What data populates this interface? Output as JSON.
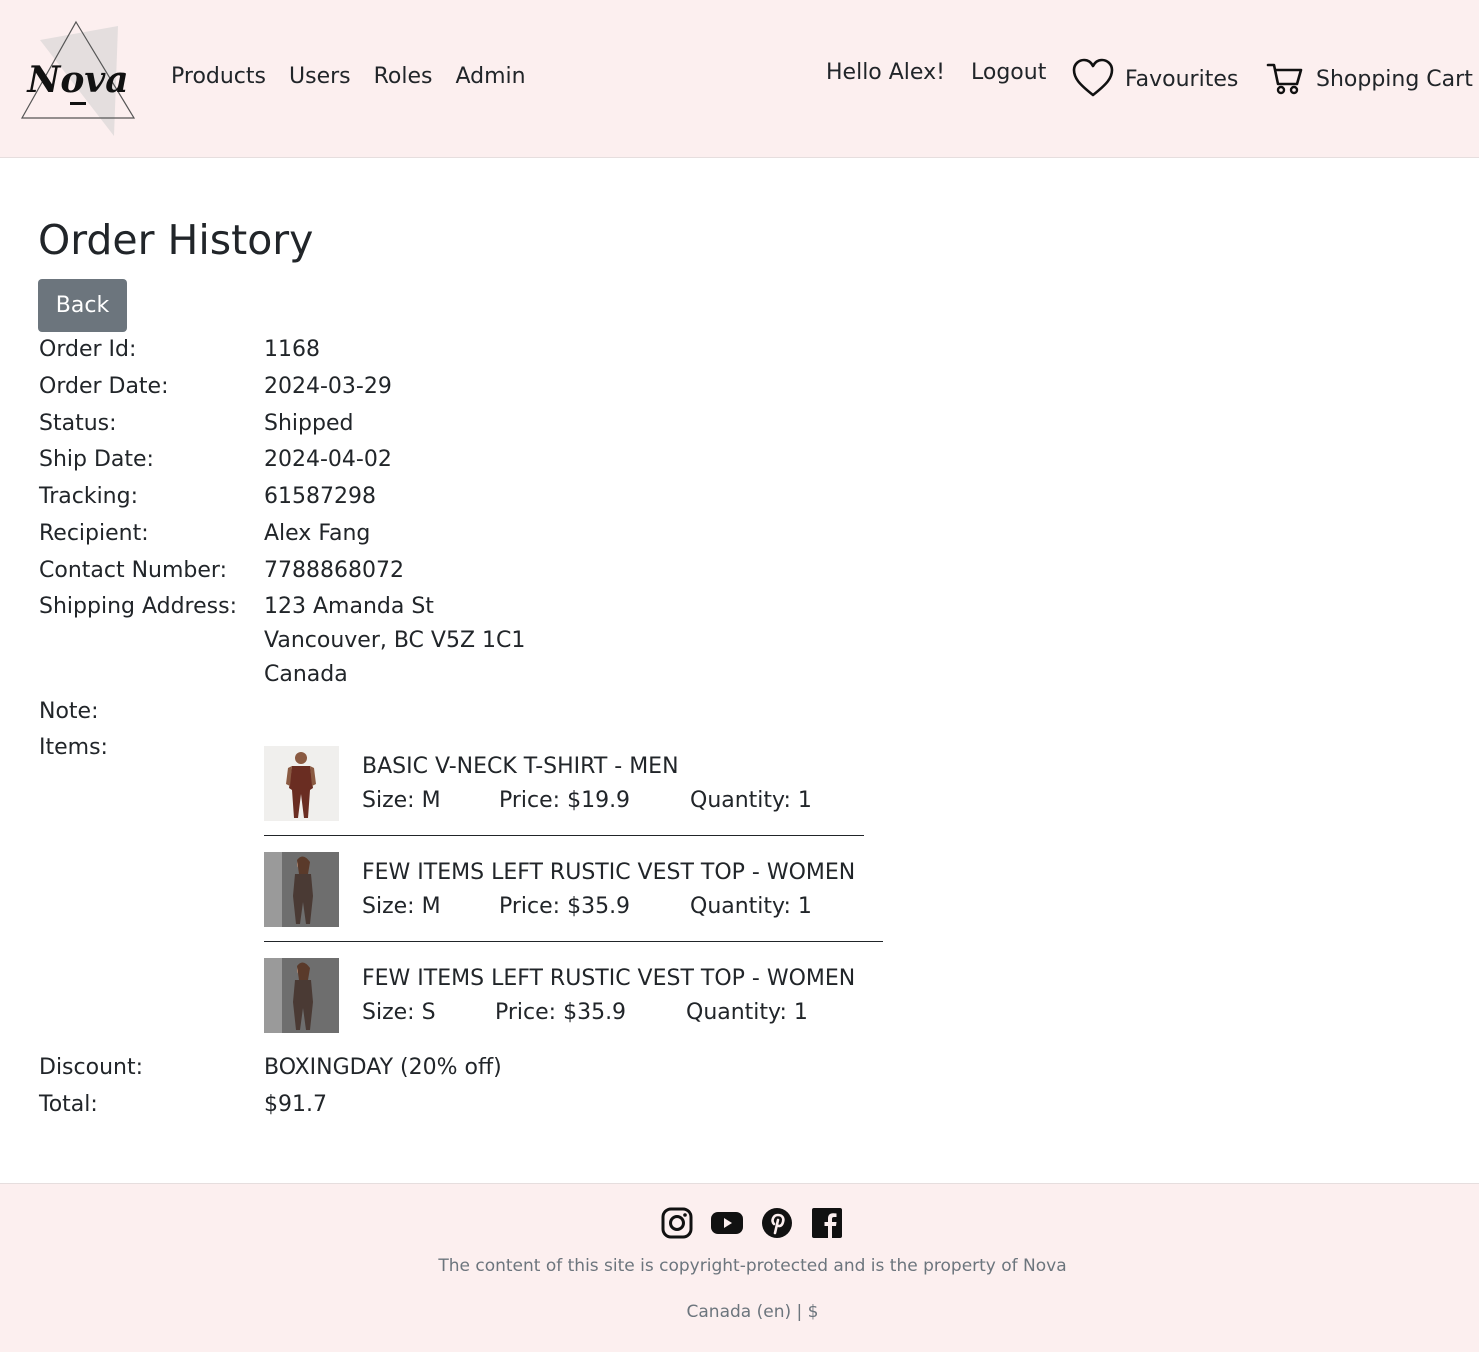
{
  "brand": {
    "logo_text": "Nova"
  },
  "nav": {
    "products": "Products",
    "users": "Users",
    "roles": "Roles",
    "admin": "Admin",
    "greeting": "Hello Alex!",
    "logout": "Logout",
    "favourites": "Favourites",
    "cart": "Shopping Cart"
  },
  "page": {
    "title": "Order History",
    "back_label": "Back"
  },
  "order": {
    "labels": {
      "id": "Order Id:",
      "date": "Order Date:",
      "status": "Status:",
      "ship_date": "Ship Date:",
      "tracking": "Tracking:",
      "recipient": "Recipient:",
      "contact": "Contact Number:",
      "address": "Shipping Address:",
      "note": "Note:",
      "items": "Items:",
      "discount": "Discount:",
      "total": "Total:"
    },
    "id": "1168",
    "date": "2024-03-29",
    "status": "Shipped",
    "ship_date": "2024-04-02",
    "tracking": "61587298",
    "recipient": "Alex Fang",
    "contact": "7788868072",
    "address": {
      "line1": "123 Amanda St",
      "line2": "Vancouver, BC V5Z 1C1",
      "line3": "Canada"
    },
    "note": "",
    "discount": "BOXINGDAY (20% off)",
    "total": "$91.7",
    "items": [
      {
        "name": "BASIC V-NECK T-SHIRT - MEN",
        "size": "Size: M",
        "price": "Price: $19.9",
        "quantity": "Quantity: 1"
      },
      {
        "name": "FEW ITEMS LEFT RUSTIC VEST TOP - WOMEN",
        "size": "Size: M",
        "price": "Price: $35.9",
        "quantity": "Quantity: 1"
      },
      {
        "name": "FEW ITEMS LEFT RUSTIC VEST TOP - WOMEN",
        "size": "Size: S",
        "price": "Price: $35.9",
        "quantity": "Quantity: 1"
      }
    ]
  },
  "footer": {
    "social": [
      "instagram-icon",
      "youtube-icon",
      "pinterest-icon",
      "facebook-icon"
    ],
    "copyright": "The content of this site is copyright-protected and is the property of Nova",
    "locale": "Canada (en) | $"
  }
}
